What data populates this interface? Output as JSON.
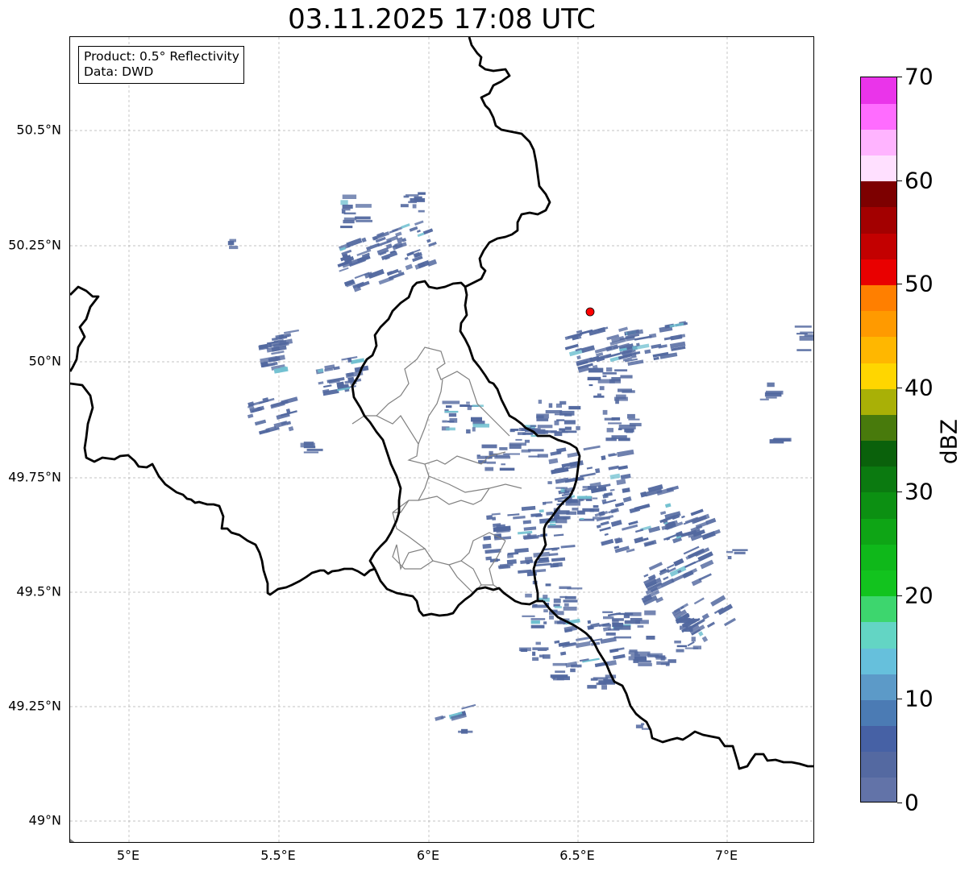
{
  "title": "03.11.2025 17:08 UTC",
  "info_box": {
    "product_line": "Product: 0.5° Reflectivity",
    "data_line": "Data: DWD"
  },
  "lat_labels": [
    "50.5°N",
    "50.25°N",
    "50°N",
    "49.75°N",
    "49.5°N",
    "49.25°N",
    "49°N"
  ],
  "lon_labels": [
    "5°E",
    "5.5°E",
    "6°E",
    "6.5°E",
    "7°E"
  ],
  "colorbar": {
    "unit": "dBZ",
    "ticks": [
      "0",
      "10",
      "20",
      "30",
      "40",
      "50",
      "60",
      "70"
    ],
    "colors": [
      "#6273a8",
      "#5469a1",
      "#4661a5",
      "#4b7bb4",
      "#5c9ac8",
      "#66c0dc",
      "#63d5c4",
      "#3dd66e",
      "#12c31e",
      "#0fb81a",
      "#0ea515",
      "#0c9012",
      "#0b7a10",
      "#0a610b",
      "#487a0c",
      "#a9b006",
      "#ffd600",
      "#ffb700",
      "#ff9a00",
      "#ff7f00",
      "#e90000",
      "#c30000",
      "#a30000",
      "#7d0000",
      "#ffe0ff",
      "#ffb4ff",
      "#ff6cff",
      "#ea34ea"
    ]
  },
  "radar_site": {
    "color": "#ff0000"
  },
  "map_colors": {
    "border": "#000000",
    "district": "#808080",
    "echo": "#52689f",
    "echo_light": "#6fc0d0",
    "grid": "#b0b0b0"
  }
}
